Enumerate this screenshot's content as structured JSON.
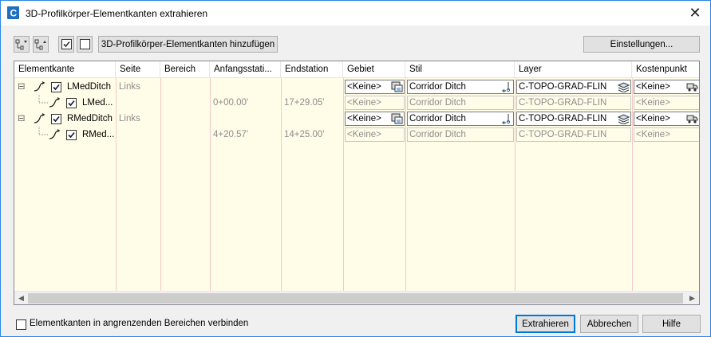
{
  "window": {
    "title": "3D-Profilkörper-Elementkanten extrahieren",
    "close_label": "✕"
  },
  "toolbar": {
    "add_button": "3D-Profilkörper-Elementkanten hinzufügen",
    "settings_button": "Einstellungen..."
  },
  "grid": {
    "columns": [
      "Elementkante",
      "Seite",
      "Bereich",
      "Anfangsstati...",
      "Endstation",
      "Gebiet",
      "Stil",
      "Layer",
      "Kostenpunkt"
    ],
    "rows": [
      {
        "level": 0,
        "expand": "⊟",
        "checked": true,
        "name": "LMedDitch",
        "side": "Links",
        "region": "",
        "start": "",
        "end": "",
        "area": "<Keine>",
        "style": "Corridor Ditch",
        "layer": "C-TOPO-GRAD-FLIN",
        "cost": "<Keine>",
        "editable": true
      },
      {
        "level": 1,
        "expand": "",
        "checked": true,
        "name": "LMed...",
        "side": "",
        "region": "",
        "start": "0+00.00'",
        "end": "17+29.05'",
        "area": "<Keine>",
        "style": "Corridor Ditch",
        "layer": "C-TOPO-GRAD-FLIN",
        "cost": "<Keine>",
        "editable": false
      },
      {
        "level": 0,
        "expand": "⊟",
        "checked": true,
        "name": "RMedDitch",
        "side": "Links",
        "region": "",
        "start": "",
        "end": "",
        "area": "<Keine>",
        "style": "Corridor Ditch",
        "layer": "C-TOPO-GRAD-FLIN",
        "cost": "<Keine>",
        "editable": true
      },
      {
        "level": 1,
        "expand": "",
        "checked": true,
        "name": "RMed...",
        "side": "",
        "region": "",
        "start": "4+20.57'",
        "end": "14+25.00'",
        "area": "<Keine>",
        "style": "Corridor Ditch",
        "layer": "C-TOPO-GRAD-FLIN",
        "cost": "<Keine>",
        "editable": false
      }
    ]
  },
  "footer": {
    "connect_label": "Elementkanten in angrenzenden Bereichen verbinden",
    "connect_checked": false,
    "extract_button": "Extrahieren",
    "cancel_button": "Abbrechen",
    "help_button": "Hilfe"
  },
  "colors": {
    "grid_bg": "#fffde8",
    "accent": "#0078d7",
    "app_icon": "#1f6fbf"
  }
}
